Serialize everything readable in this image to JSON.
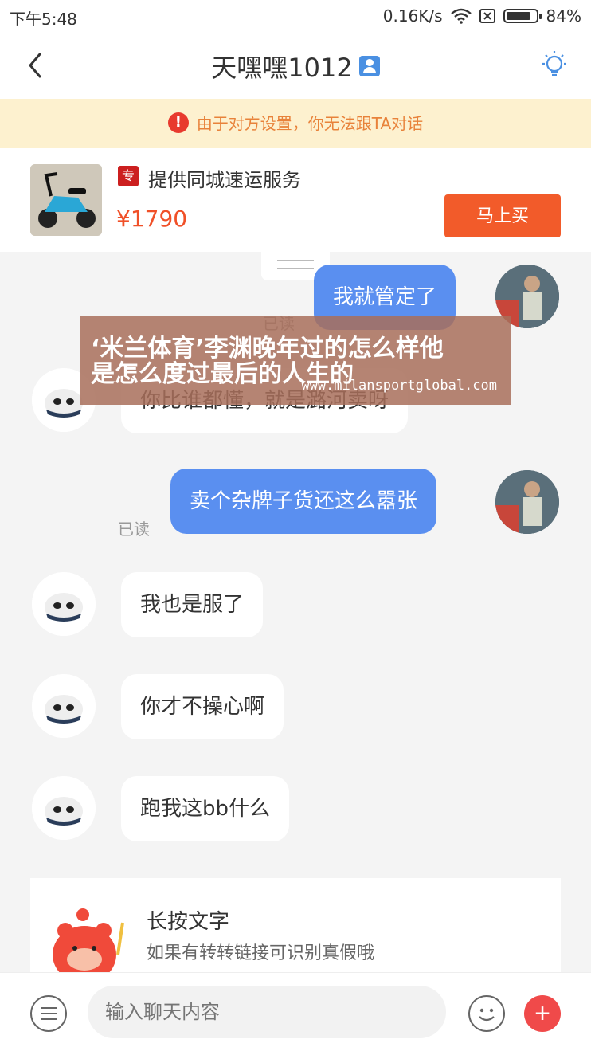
{
  "status_bar": {
    "time": "下午5:48",
    "speed": "0.16K/s",
    "battery": "84%",
    "battery_level": 0.84
  },
  "header": {
    "title": "天嘿嘿1012"
  },
  "notice": {
    "text": "由于对方设置，你无法跟TA对话"
  },
  "product": {
    "tag": "专",
    "title": "提供同城速运服务",
    "price": "¥1790",
    "buy_label": "马上买"
  },
  "messages": [
    {
      "side": "out",
      "text": "我就管定了",
      "status": "已读"
    },
    {
      "side": "in",
      "text": "你比谁都懂，就是潞河卖呀"
    },
    {
      "side": "out",
      "text": "卖个杂牌子货还这么嚣张",
      "status": "已读"
    },
    {
      "side": "in",
      "text": "我也是服了"
    },
    {
      "side": "in",
      "text": "你才不操心啊"
    },
    {
      "side": "in",
      "text": "跑我这bb什么"
    }
  ],
  "tip_card": {
    "title": "长按文字",
    "subtitle": "如果有转转链接可识别真假哦"
  },
  "input_bar": {
    "placeholder": "输入聊天内容"
  },
  "overlay": {
    "line1": "‘米兰体育’李渊晚年过的怎么样他",
    "line2": "是怎么度过最后的人生的",
    "url": "www.milansportglobal.com"
  },
  "colors": {
    "accent": "#f25b2a",
    "bubble_out": "#5a8ff0",
    "notice_bg": "#fdf1cf",
    "notice_text": "#e8823a"
  }
}
